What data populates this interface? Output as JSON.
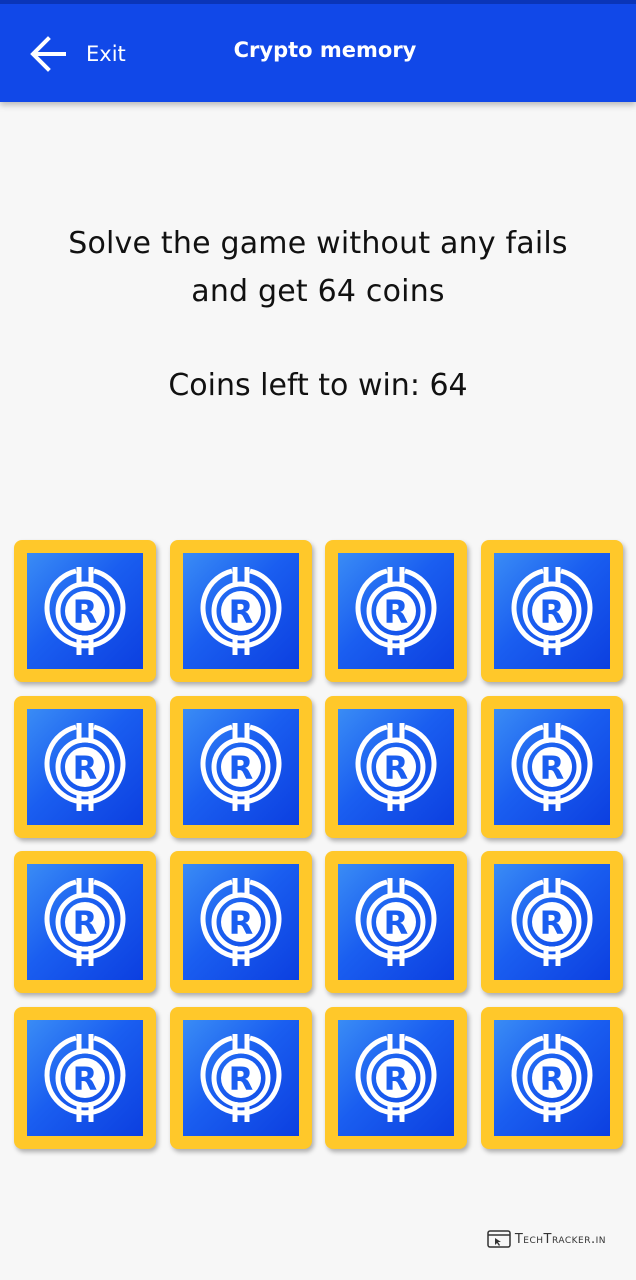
{
  "header": {
    "back_label": "Exit",
    "title": "Crypto memory",
    "background_color": "#1148e8"
  },
  "instructions": {
    "line1": "Solve the game without any fails",
    "line2": "and get 64 coins"
  },
  "coins_left": "Coins left to win: 64",
  "board": {
    "rows": 4,
    "columns": 4,
    "card_count": 16,
    "card_state": "face-down",
    "card_back_icon": "r-coin-icon",
    "card_border_color": "#ffc82a",
    "card_face_color": "#1a5ef0"
  },
  "watermark": {
    "text": "TechTracker.in"
  }
}
